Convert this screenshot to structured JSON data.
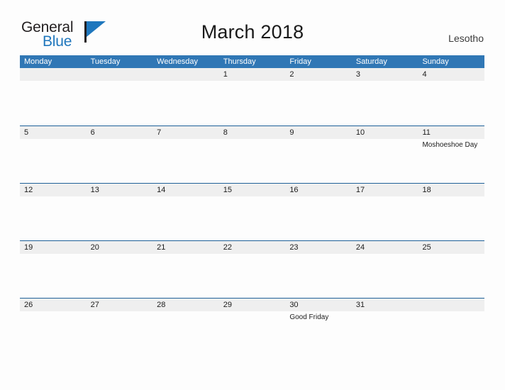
{
  "brand": {
    "name_part1": "General",
    "name_part2": "Blue",
    "flag_icon": "blue-flag-icon",
    "accent_color": "#2077bd"
  },
  "header": {
    "title": "March 2018",
    "country": "Lesotho"
  },
  "calendar": {
    "header_color": "#3077b5",
    "band_color": "#efefef",
    "rule_color": "#1f6199",
    "weekday_headers": [
      "Monday",
      "Tuesday",
      "Wednesday",
      "Thursday",
      "Friday",
      "Saturday",
      "Sunday"
    ],
    "weeks": [
      [
        {
          "date": "",
          "event": ""
        },
        {
          "date": "",
          "event": ""
        },
        {
          "date": "",
          "event": ""
        },
        {
          "date": "1",
          "event": ""
        },
        {
          "date": "2",
          "event": ""
        },
        {
          "date": "3",
          "event": ""
        },
        {
          "date": "4",
          "event": ""
        }
      ],
      [
        {
          "date": "5",
          "event": ""
        },
        {
          "date": "6",
          "event": ""
        },
        {
          "date": "7",
          "event": ""
        },
        {
          "date": "8",
          "event": ""
        },
        {
          "date": "9",
          "event": ""
        },
        {
          "date": "10",
          "event": ""
        },
        {
          "date": "11",
          "event": "Moshoeshoe Day"
        }
      ],
      [
        {
          "date": "12",
          "event": ""
        },
        {
          "date": "13",
          "event": ""
        },
        {
          "date": "14",
          "event": ""
        },
        {
          "date": "15",
          "event": ""
        },
        {
          "date": "16",
          "event": ""
        },
        {
          "date": "17",
          "event": ""
        },
        {
          "date": "18",
          "event": ""
        }
      ],
      [
        {
          "date": "19",
          "event": ""
        },
        {
          "date": "20",
          "event": ""
        },
        {
          "date": "21",
          "event": ""
        },
        {
          "date": "22",
          "event": ""
        },
        {
          "date": "23",
          "event": ""
        },
        {
          "date": "24",
          "event": ""
        },
        {
          "date": "25",
          "event": ""
        }
      ],
      [
        {
          "date": "26",
          "event": ""
        },
        {
          "date": "27",
          "event": ""
        },
        {
          "date": "28",
          "event": ""
        },
        {
          "date": "29",
          "event": ""
        },
        {
          "date": "30",
          "event": "Good Friday"
        },
        {
          "date": "31",
          "event": ""
        },
        {
          "date": "",
          "event": ""
        }
      ]
    ]
  }
}
